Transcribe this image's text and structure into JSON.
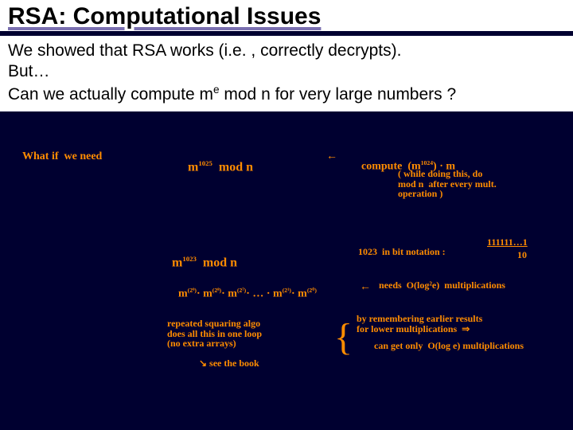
{
  "title": "RSA: Computational Issues",
  "body": {
    "line1": "We showed that RSA works (i.e. , correctly decrypts).",
    "line2": "But…",
    "line3a": "Can we actually compute m",
    "line3exp": "e",
    "line3b": " mod n for very large numbers ?"
  },
  "hw": {
    "what_if": "What if  we need",
    "m1025": "m",
    "m1025_exp": "1025",
    "m1025_tail": "  mod n",
    "arrow_l1": "←",
    "compute": "compute  (m",
    "compute_exp": "1024",
    "compute_tail": ") · m",
    "note_paren": "( while doing this, do\nmod n  after every mult.\noperation )",
    "m1023": "m",
    "m1023_exp": "1023",
    "m1023_tail": "  mod n",
    "bitnote": "1023  in bit notation :",
    "bits": "111111…1",
    "bits_sub": "10",
    "mprod": "m",
    "mprod_a_exp": "(2⁹)",
    "mprod_dot1": "· m",
    "mprod_b_exp": "(2⁸)",
    "mprod_dot2": "· m",
    "mprod_c_exp": "(2⁷)",
    "mprod_dots": "· … · m",
    "mprod_d_exp": "(2¹)",
    "mprod_dot3": "· m",
    "mprod_e_exp": "(2⁰)",
    "arrow_l2": "←",
    "needs": "needs  O(log²e)  multiplications",
    "algo_note": "repeated squaring algo\ndoes all this in one loop\n(no extra arrays)",
    "see_book": "↘ see the book",
    "brace_note_top": "by remembering earlier results\nfor lower multiplications  ⇒",
    "brace_note_bot": "can get only  O(log e) multiplications"
  }
}
